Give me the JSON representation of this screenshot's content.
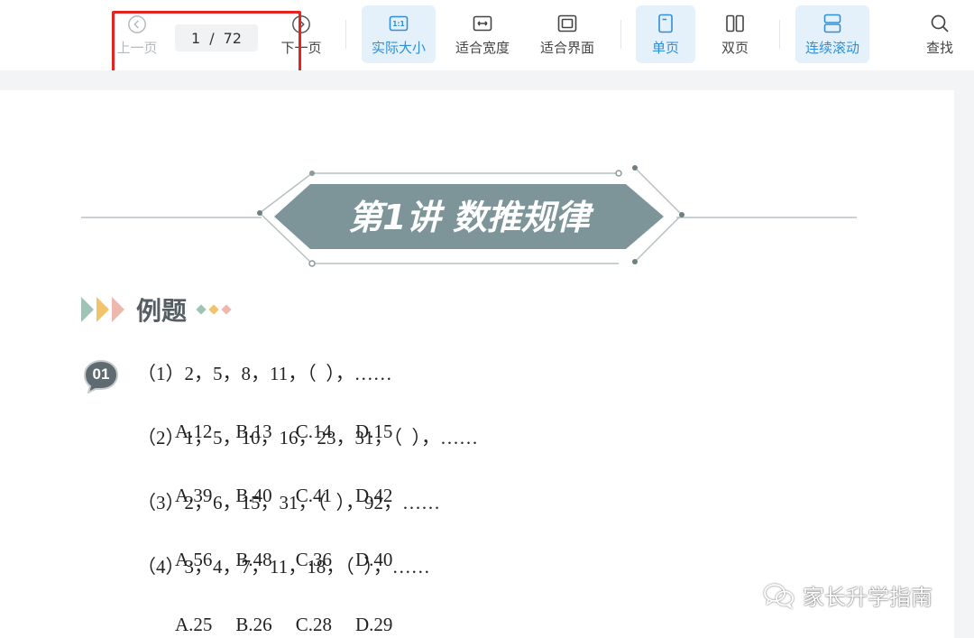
{
  "toolbar": {
    "pager": {
      "prev_label": "上一页",
      "next_label": "下一页",
      "current_page": "1",
      "separator": "/",
      "total_pages": "72"
    },
    "buttons": [
      {
        "label": "实际大小",
        "icon": "actual-size-icon",
        "active": true
      },
      {
        "label": "适合宽度",
        "icon": "fit-width-icon",
        "active": false
      },
      {
        "label": "适合界面",
        "icon": "fit-page-icon",
        "active": false
      },
      {
        "label": "单页",
        "icon": "single-page-icon",
        "active": true
      },
      {
        "label": "双页",
        "icon": "two-page-icon",
        "active": false
      },
      {
        "label": "连续滚动",
        "icon": "continuous-scroll-icon",
        "active": true
      },
      {
        "label": "查找",
        "icon": "search-icon",
        "active": false
      }
    ],
    "actual_size_icon_text": "1:1",
    "accent_color": "#2f8fd8",
    "highlight_color": "#e8221e"
  },
  "document": {
    "banner_title": "第1讲 数推规律",
    "banner_color": "#7d9598",
    "section_title": "例题",
    "question_badge": "01",
    "problems": [
      {
        "stem": "（1）2，5，8，11，（  ），……",
        "options": [
          "A.12",
          "B.13",
          "C.14",
          "D.15"
        ]
      },
      {
        "stem": "（2）1，5，10，16，23，31，（  ），……",
        "options": [
          "A.39",
          "B.40",
          "C.41",
          "D.42"
        ]
      },
      {
        "stem": "（3）2，6，15，31，（  ），92，……",
        "options": [
          "A.56",
          "B.48",
          "C.36",
          "D.40"
        ]
      },
      {
        "stem": "（4）3，4，7，11，18，（  ），……",
        "options": [
          "A.25",
          "B.26",
          "C.28",
          "D.29"
        ]
      }
    ]
  },
  "watermark": {
    "text": "家长升学指南",
    "icon": "wechat-icon"
  }
}
